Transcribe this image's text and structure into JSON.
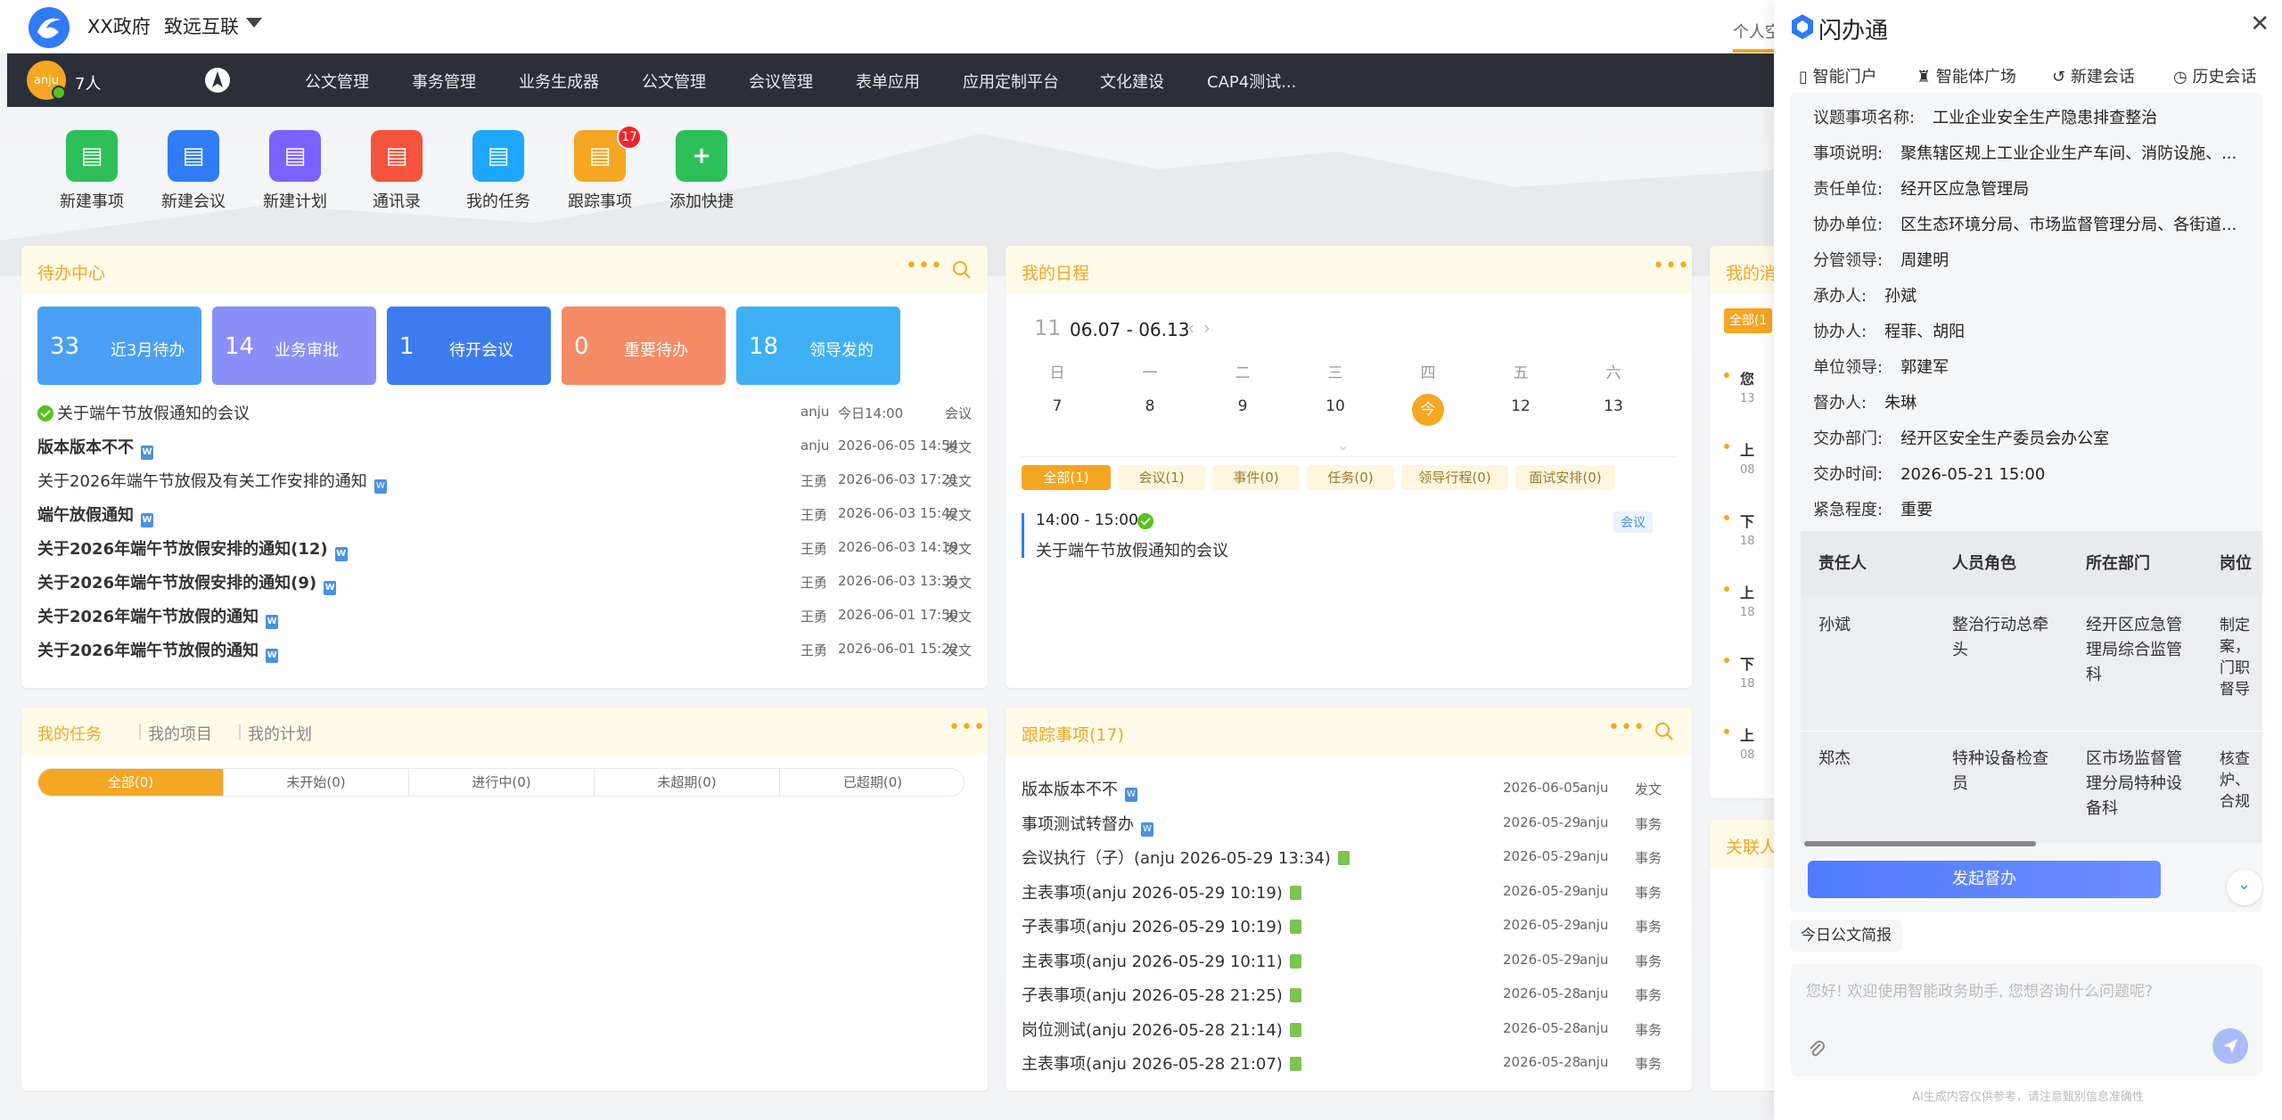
{
  "header": {
    "org": "XX政府",
    "org2": "致远互联",
    "personal": "个人空"
  },
  "nav": {
    "avatar": "anju",
    "people": "7人",
    "items": [
      "公文管理",
      "事务管理",
      "业务生成器",
      "公文管理",
      "会议管理",
      "表单应用",
      "应用定制平台",
      "文化建设",
      "CAP4测试..."
    ]
  },
  "quick": [
    {
      "label": "新建事项",
      "color": "#2fbf5a",
      "icon": "new-item-icon"
    },
    {
      "label": "新建会议",
      "color": "#2f7cf6",
      "icon": "meeting-icon"
    },
    {
      "label": "新建计划",
      "color": "#7b61ff",
      "icon": "calendar-icon"
    },
    {
      "label": "通讯录",
      "color": "#f5533d",
      "icon": "contacts-icon"
    },
    {
      "label": "我的任务",
      "color": "#1ea7ff",
      "icon": "task-icon"
    },
    {
      "label": "跟踪事项",
      "color": "#f5a623",
      "icon": "track-icon",
      "badge": "17"
    },
    {
      "label": "添加快捷",
      "color": "#2fbf5a",
      "icon": "plus-icon"
    }
  ],
  "todo": {
    "title": "待办中心",
    "stats": [
      {
        "n": "33",
        "t": "近3月待办",
        "color": "#4a9ff5"
      },
      {
        "n": "14",
        "t": "业务审批",
        "color": "#8a8ff7"
      },
      {
        "n": "1",
        "t": "待开会议",
        "color": "#3d7cf0"
      },
      {
        "n": "0",
        "t": "重要待办",
        "color": "#f58a66"
      },
      {
        "n": "18",
        "t": "领导发的",
        "color": "#3fb0f5"
      }
    ],
    "rows": [
      {
        "title": "关于端午节放假通知的会议",
        "author": "anju",
        "date": "今日14:00",
        "type": "会议",
        "bold": false,
        "check": true,
        "doc": false
      },
      {
        "title": "版本版本不不",
        "author": "anju",
        "date": "2026-06-05 14:54",
        "type": "发文",
        "bold": true,
        "doc": true
      },
      {
        "title": "关于2026年端午节放假及有关工作安排的通知",
        "author": "王勇",
        "date": "2026-06-03 17:21",
        "type": "发文",
        "bold": false,
        "doc": true
      },
      {
        "title": "端午放假通知",
        "author": "王勇",
        "date": "2026-06-03 15:42",
        "type": "发文",
        "bold": true,
        "doc": true
      },
      {
        "title": "关于2026年端午节放假安排的通知(12)",
        "author": "王勇",
        "date": "2026-06-03 14:19",
        "type": "发文",
        "bold": true,
        "doc": true
      },
      {
        "title": "关于2026年端午节放假安排的通知(9)",
        "author": "王勇",
        "date": "2026-06-03 13:35",
        "type": "发文",
        "bold": true,
        "doc": true
      },
      {
        "title": "关于2026年端午节放假的通知",
        "author": "王勇",
        "date": "2026-06-01 17:50",
        "type": "发文",
        "bold": true,
        "doc": true
      },
      {
        "title": "关于2026年端午节放假的通知",
        "author": "王勇",
        "date": "2026-06-01 15:22",
        "type": "发文",
        "bold": true,
        "doc": true
      }
    ]
  },
  "schedule": {
    "title": "我的日程",
    "week_no": "11",
    "range": "06.07 - 06.13",
    "weekdays": [
      "日",
      "一",
      "二",
      "三",
      "四",
      "五",
      "六"
    ],
    "days": [
      "7",
      "8",
      "9",
      "10",
      "今",
      "12",
      "13"
    ],
    "chips": [
      "全部(1)",
      "会议(1)",
      "事件(0)",
      "任务(0)",
      "领导行程(0)",
      "面试安排(0)"
    ],
    "event_time": "14:00 - 15:00",
    "event_title": "关于端午节放假通知的会议",
    "event_tag": "会议"
  },
  "tasks": {
    "tabs": [
      "我的任务",
      "我的项目",
      "我的计划"
    ],
    "seg": [
      "全部(0)",
      "未开始(0)",
      "进行中(0)",
      "未超期(0)",
      "已超期(0)"
    ]
  },
  "track": {
    "title": "跟踪事项(17)",
    "rows": [
      {
        "title": "版本版本不不",
        "date": "2026-06-05",
        "author": "anju",
        "type": "发文",
        "icon": "doc"
      },
      {
        "title": "事项测试转督办",
        "date": "2026-05-29",
        "author": "anju",
        "type": "事务",
        "icon": "doc"
      },
      {
        "title": "会议执行（子）(anju 2026-05-29 13:34)",
        "date": "2026-05-29",
        "author": "anju",
        "type": "事务",
        "icon": "xls"
      },
      {
        "title": "主表事项(anju 2026-05-29 10:19)",
        "date": "2026-05-29",
        "author": "anju",
        "type": "事务",
        "icon": "xls"
      },
      {
        "title": "子表事项(anju 2026-05-29 10:19)",
        "date": "2026-05-29",
        "author": "anju",
        "type": "事务",
        "icon": "xls"
      },
      {
        "title": "主表事项(anju 2026-05-29 10:11)",
        "date": "2026-05-29",
        "author": "anju",
        "type": "事务",
        "icon": "xls"
      },
      {
        "title": "子表事项(anju 2026-05-28 21:25)",
        "date": "2026-05-28",
        "author": "anju",
        "type": "事务",
        "icon": "xls"
      },
      {
        "title": "岗位测试(anju 2026-05-28 21:14)",
        "date": "2026-05-28",
        "author": "anju",
        "type": "事务",
        "icon": "xls"
      },
      {
        "title": "主表事项(anju 2026-05-28 21:07)",
        "date": "2026-05-28",
        "author": "anju",
        "type": "事务",
        "icon": "xls"
      }
    ]
  },
  "partial": {
    "msg_title": "我的消",
    "tab": "全部(1",
    "rows": [
      "您",
      "上",
      "下",
      "上",
      "下",
      "上"
    ],
    "rows_small": [
      "13",
      "08",
      "18",
      "18",
      "18",
      "08"
    ],
    "related": "关联人"
  },
  "panel": {
    "title": "闪办通",
    "tabs": [
      "智能门户",
      "智能体广场",
      "新建会话",
      "历史会话"
    ],
    "fields": [
      {
        "k": "议题事项名称:",
        "v": "工业企业安全生产隐患排查整治"
      },
      {
        "k": "事项说明:",
        "v": "聚焦辖区规上工业企业生产车间、消防设施、..."
      },
      {
        "k": "责任单位:",
        "v": "经开区应急管理局"
      },
      {
        "k": "协办单位:",
        "v": "区生态环境分局、市场监督管理分局、各街道..."
      },
      {
        "k": "分管领导:",
        "v": "周建明"
      },
      {
        "k": "承办人:",
        "v": "孙斌"
      },
      {
        "k": "协办人:",
        "v": "程菲、胡阳"
      },
      {
        "k": "单位领导:",
        "v": "郭建军"
      },
      {
        "k": "督办人:",
        "v": "朱琳"
      },
      {
        "k": "交办部门:",
        "v": "经开区安全生产委员会办公室"
      },
      {
        "k": "交办时间:",
        "v": "2026-05-21 15:00"
      },
      {
        "k": "紧急程度:",
        "v": "重要"
      }
    ],
    "table_head": [
      "责任人",
      "人员角色",
      "所在部门",
      "岗位"
    ],
    "table_rows": [
      {
        "name": "孙斌",
        "role": [
          "整治行动总牵",
          "头"
        ],
        "dept": [
          "经开区应急管",
          "理局综合监管",
          "科"
        ],
        "post": [
          "制定",
          "案，",
          "门职",
          "督导"
        ]
      },
      {
        "name": "郑杰",
        "role": [
          "特种设备检查",
          "员"
        ],
        "dept": [
          "区市场监督管",
          "理分局特种设",
          "备科"
        ],
        "post": [
          "核查",
          "炉、",
          "合规"
        ]
      }
    ],
    "button": "发起督办",
    "brief": "今日公文简报",
    "placeholder": "您好! 欢迎使用智能政务助手, 您想咨询什么问题呢?",
    "disclaimer": "AI生成内容仅供参考，请注意甄别信息准确性"
  }
}
